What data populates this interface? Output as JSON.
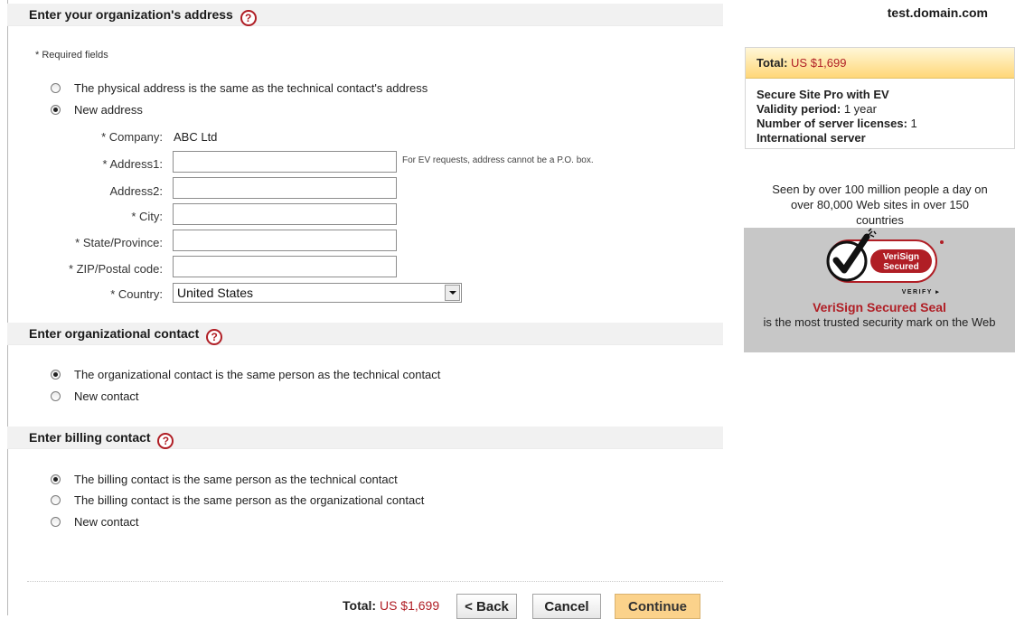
{
  "header": {
    "address_title": "Enter your organization's address",
    "domain": "test.domain.com",
    "help_glyph": "?"
  },
  "required_note": "* Required fields",
  "address_options": [
    {
      "label": "The physical address is the same as the technical contact's address",
      "selected": false
    },
    {
      "label": "New address",
      "selected": true
    }
  ],
  "form": {
    "company_label": "* Company:",
    "company_value": "ABC Ltd",
    "address1_label": "* Address1:",
    "address1_value": "",
    "address1_hint": "For EV requests, address cannot be a P.O. box.",
    "address2_label": "Address2:",
    "address2_value": "",
    "city_label": "* City:",
    "city_value": "",
    "state_label": "* State/Province:",
    "state_value": "",
    "zip_label": "* ZIP/Postal code:",
    "zip_value": "",
    "country_label": "* Country:",
    "country_value": "United States"
  },
  "org_contact": {
    "title": "Enter organizational contact",
    "options": [
      {
        "label": "The organizational contact is the same person as the technical contact",
        "selected": true
      },
      {
        "label": "New contact",
        "selected": false
      }
    ]
  },
  "billing_contact": {
    "title": "Enter billing contact",
    "options": [
      {
        "label": "The billing contact is the same person as the technical contact",
        "selected": true
      },
      {
        "label": "The billing contact is the same person as the organizational contact",
        "selected": false
      },
      {
        "label": "New contact",
        "selected": false
      }
    ]
  },
  "footer": {
    "total_label": "Total:",
    "total_value": "US $1,699",
    "back_label": "< Back",
    "cancel_label": "Cancel",
    "continue_label": "Continue"
  },
  "summary": {
    "total_label": "Total:",
    "total_value": "US $1,699",
    "product": "Secure Site Pro with EV",
    "validity_label": "Validity period:",
    "validity_value": "1 year",
    "licenses_label": "Number of server licenses:",
    "licenses_value": "1",
    "server_type": "International server"
  },
  "trust": {
    "seen_line1": "Seen by over 100 million people a day on",
    "seen_line2": "over 80,000 Web sites in over 150",
    "seen_line3": "countries",
    "seal_text1": "VeriSign",
    "seal_text2": "Secured",
    "seal_verify": "VERIFY ▸",
    "seal_title": "VeriSign Secured Seal",
    "seal_desc": "is the most trusted security mark on the Web"
  },
  "colors": {
    "brand_red": "#b01e25",
    "header_gray": "#f1f1f1",
    "continue_bg": "#fbd28b"
  }
}
